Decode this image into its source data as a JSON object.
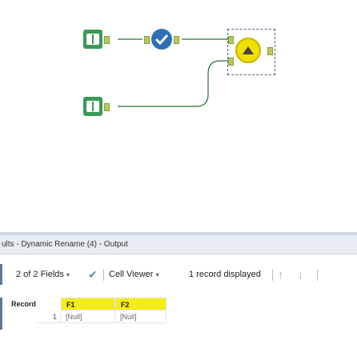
{
  "canvas": {
    "tools": [
      {
        "name": "input-data-tool-1",
        "icon": "book-icon"
      },
      {
        "name": "select-tool",
        "icon": "checkmark-icon"
      },
      {
        "name": "dynamic-rename-tool",
        "icon": "rename-gear-icon"
      },
      {
        "name": "input-data-tool-2",
        "icon": "book-icon"
      }
    ],
    "colors": {
      "input": "#3b9a58",
      "select": "#2f6fb5",
      "rename": "#f0e000",
      "connector": "#2c6e3a"
    }
  },
  "results": {
    "title": "ults - Dynamic Rename (4) - Output",
    "toolbar": {
      "fields": "2 of 2 Fields",
      "viewer": "Cell Viewer",
      "records_displayed": "1 record displayed"
    },
    "grid": {
      "columns": [
        "Record",
        "F1",
        "F2"
      ],
      "rows": [
        {
          "record": "1",
          "F1": "[Null]",
          "F2": "[Null]"
        }
      ]
    }
  }
}
